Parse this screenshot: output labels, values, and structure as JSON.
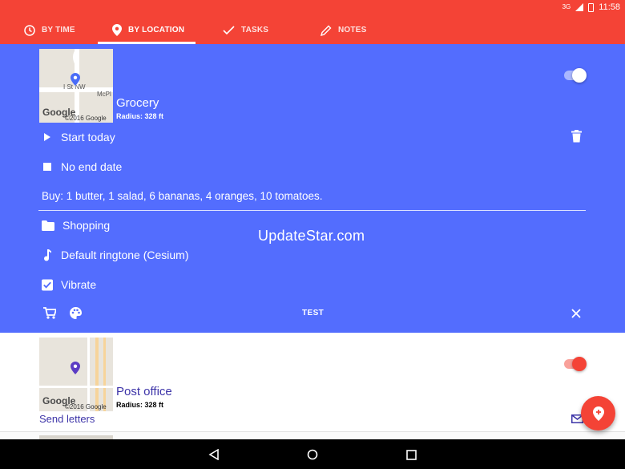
{
  "status_bar": {
    "signal": "3G",
    "time": "11:58"
  },
  "tabs": [
    {
      "label": "BY TIME",
      "icon": "clock-icon",
      "active": false
    },
    {
      "label": "BY LOCATION",
      "icon": "location-pin-icon",
      "active": true
    },
    {
      "label": "TASKS",
      "icon": "check-icon",
      "active": false
    },
    {
      "label": "NOTES",
      "icon": "pencil-icon",
      "active": false
    }
  ],
  "reminder1": {
    "title": "Grocery",
    "radius": "Radius: 328 ft",
    "map_logo": "Google",
    "map_copyright": "©2016 Google",
    "map_street": "I St NW",
    "map_street2": "McPl",
    "enabled": true,
    "start": "Start today",
    "end": "No end date",
    "summary": "Buy: 1 butter, 1 salad, 6 bananas, 4 oranges, 10 tomatoes.",
    "category": "Shopping",
    "ringtone": "Default ringtone (Cesium)",
    "vibrate": "Vibrate",
    "vibrate_checked": true,
    "test_label": "TEST"
  },
  "reminder2": {
    "title": "Post office",
    "radius": "Radius: 328 ft",
    "map_logo": "Google",
    "map_copyright": "©2016 Google",
    "summary": "Send letters",
    "enabled": true
  },
  "watermark": "UpdateStar.com",
  "colors": {
    "accent": "#f44336",
    "card_selected": "#536dfe",
    "title_dark": "#3d34a8"
  }
}
